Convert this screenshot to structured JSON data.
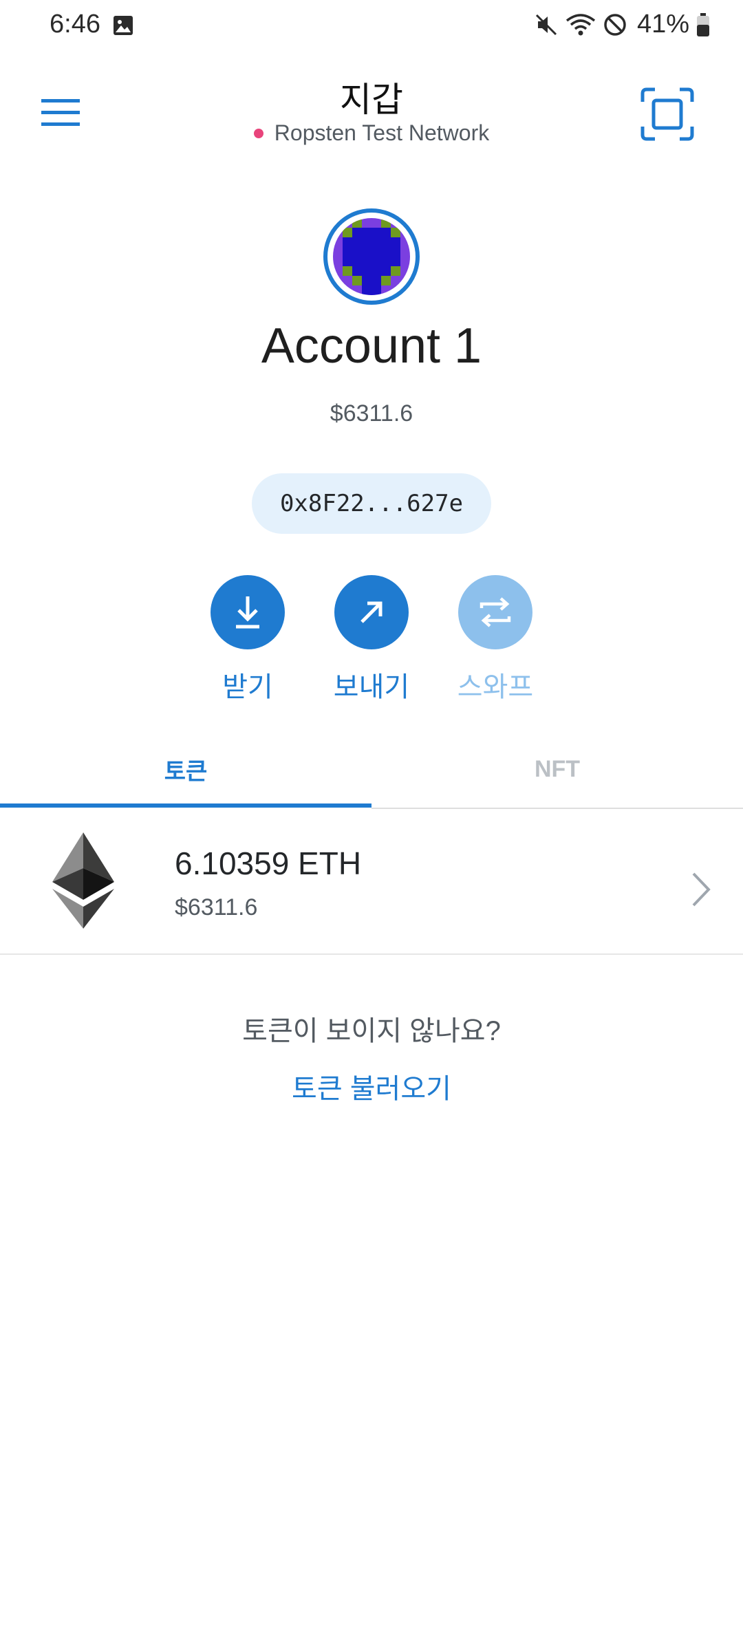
{
  "status_bar": {
    "time": "6:46",
    "battery": "41%",
    "icons": [
      "image-icon",
      "mute-icon",
      "wifi-icon",
      "dnd-icon",
      "battery-icon"
    ]
  },
  "header": {
    "title": "지갑",
    "network": "Ropsten Test Network",
    "network_dot_color": "#e8447b",
    "menu_icon": "hamburger-icon",
    "scan_icon": "scan-icon"
  },
  "account": {
    "name": "Account 1",
    "balance": "$6311.6",
    "address": "0x8F22...627e"
  },
  "actions": [
    {
      "label": "받기",
      "icon": "receive-icon",
      "enabled": true
    },
    {
      "label": "보내기",
      "icon": "send-icon",
      "enabled": true
    },
    {
      "label": "스와프",
      "icon": "swap-icon",
      "enabled": false
    }
  ],
  "tabs": [
    {
      "label": "토큰",
      "active": true
    },
    {
      "label": "NFT",
      "active": false
    }
  ],
  "tokens": [
    {
      "amount": "6.10359 ETH",
      "fiat": "$6311.6",
      "icon": "ethereum-icon"
    }
  ],
  "footer": {
    "question": "토큰이 보이지 않나요?",
    "import_link": "토큰 불러오기"
  },
  "colors": {
    "accent": "#1f7bd0",
    "accent_disabled": "#8dc0ec",
    "address_bg": "#e4f1fc"
  }
}
